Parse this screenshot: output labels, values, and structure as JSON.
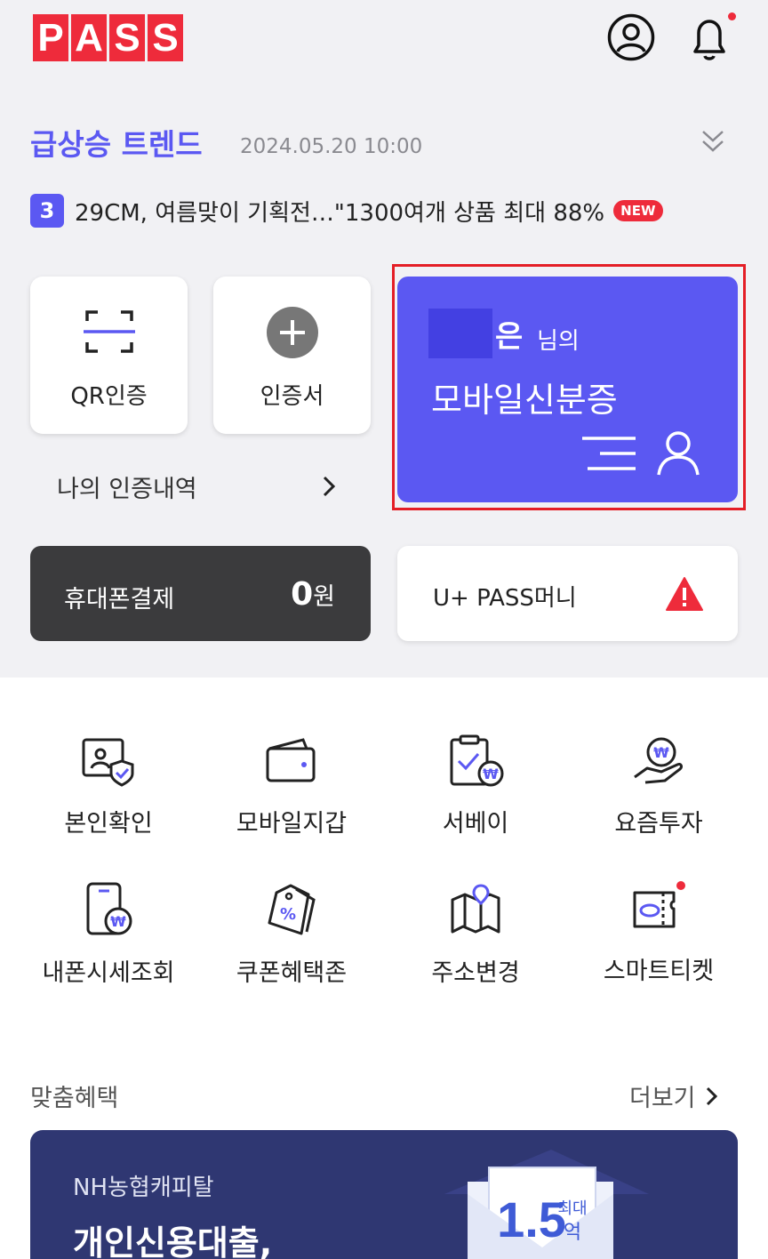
{
  "header": {
    "logo_letters": [
      "P",
      "A",
      "S",
      "S"
    ],
    "profile_icon": "user-circle-icon",
    "notification_icon": "bell-icon",
    "brand_color": "#ee2b3b"
  },
  "trend": {
    "title": "급상승 트렌드",
    "timestamp": "2024.05.20 10:00",
    "rank": "3",
    "headline": "29CM, 여름맞이 기획전…\"1300여개 상품 최대 88%",
    "new_badge": "NEW",
    "accent_color": "#5b58f2"
  },
  "quick": {
    "qr_label": "QR인증",
    "cert_label": "인증서",
    "history_label": "나의 인증내역"
  },
  "id_card": {
    "name_suffix": "은",
    "possessive": "님의",
    "title": "모바일신분증",
    "highlight_color": "#e41e26"
  },
  "payment": {
    "label": "휴대폰결제",
    "amount": "0",
    "currency": "원"
  },
  "money": {
    "label": "U+ PASS머니",
    "icon": "warning-icon"
  },
  "services": [
    {
      "label": "본인확인",
      "icon": "id-verify-icon"
    },
    {
      "label": "모바일지갑",
      "icon": "wallet-icon"
    },
    {
      "label": "서베이",
      "icon": "survey-icon"
    },
    {
      "label": "요즘투자",
      "icon": "invest-icon"
    },
    {
      "label": "내폰시세조회",
      "icon": "phone-price-icon"
    },
    {
      "label": "쿠폰혜택존",
      "icon": "coupon-icon"
    },
    {
      "label": "주소변경",
      "icon": "map-icon"
    },
    {
      "label": "스마트티켓",
      "icon": "ticket-icon"
    }
  ],
  "benefits": {
    "title": "맞춤혜택",
    "more_label": "더보기",
    "banner": {
      "company": "NH농협캐피탈",
      "headline": "개인신용대출,",
      "badge_number": "1.5",
      "badge_top": "최대",
      "badge_bottom": "억"
    }
  }
}
